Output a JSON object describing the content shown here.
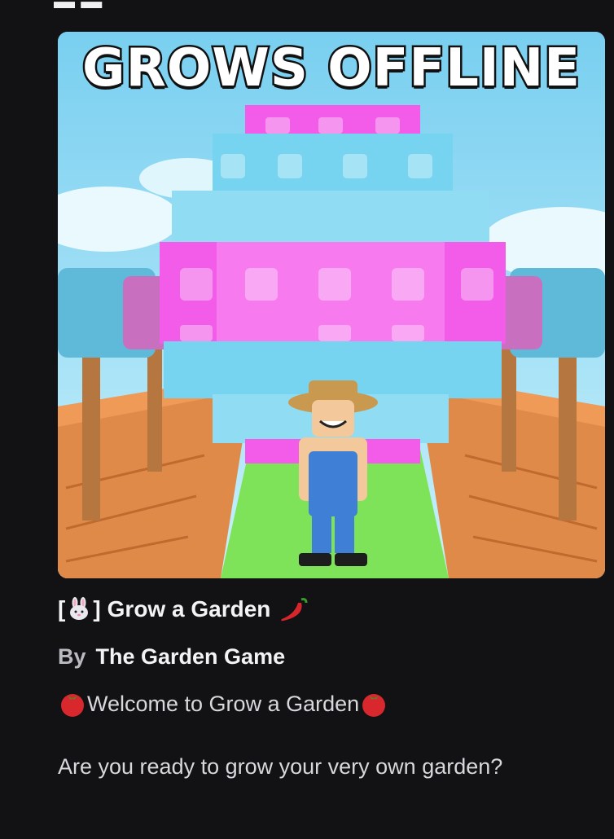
{
  "game": {
    "thumbnail_caption": "GROWS OFFLINE",
    "title_open_bracket": "[",
    "title_close_bracket": "]",
    "title_text": "Grow a Garden",
    "title_leading_emoji": "rabbit-face",
    "title_trailing_emoji": "hot-pepper"
  },
  "creator": {
    "by_label": "By",
    "name": "The Garden Game"
  },
  "description": {
    "welcome_text": "Welcome to Grow a Garden",
    "welcome_emoji": "tomato",
    "line2": "Are you ready to grow your very own garden?"
  },
  "colors": {
    "background": "#121215",
    "text": "#f3f3f5",
    "muted": "#b9bac0",
    "sky": "#8fd9ef",
    "egg_pink": "#f25ce8",
    "egg_blue": "#77d4f0",
    "grass": "#7fe35a",
    "soil": "#e08a4a"
  }
}
